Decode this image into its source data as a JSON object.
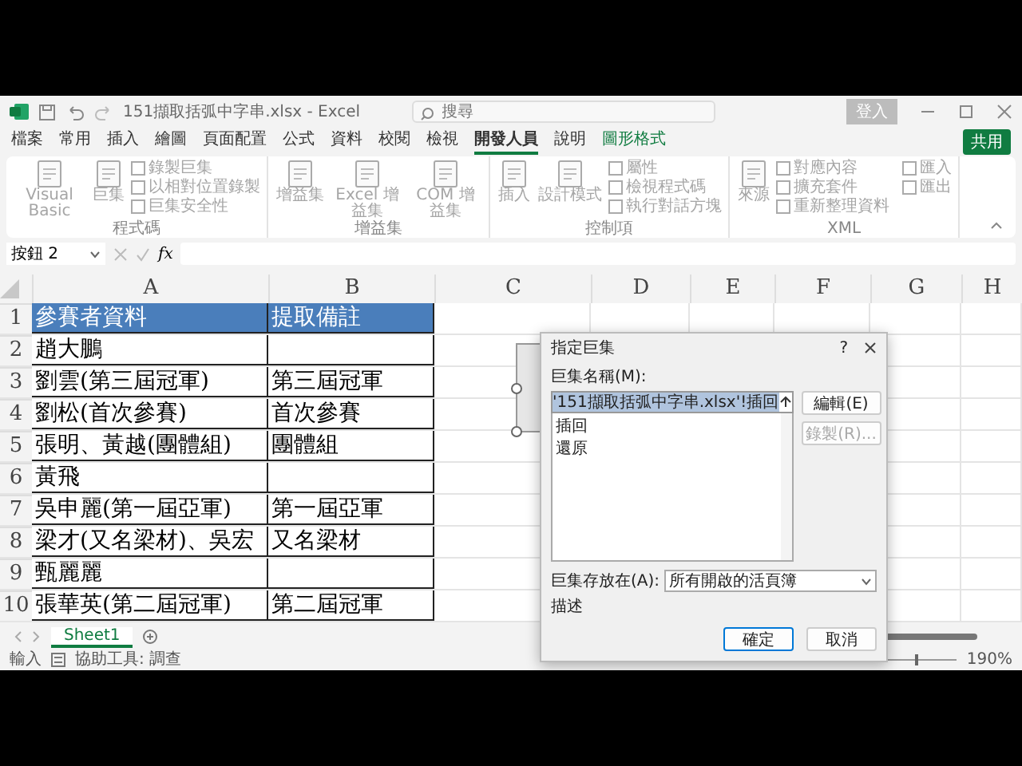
{
  "title_bar": {
    "title": "151擷取括弧中字串.xlsx - Excel",
    "search_placeholder": "搜尋",
    "sign_in": "登入"
  },
  "menu_tabs": [
    {
      "label": "檔案",
      "selected": false,
      "contextual": false
    },
    {
      "label": "常用",
      "selected": false,
      "contextual": false
    },
    {
      "label": "插入",
      "selected": false,
      "contextual": false
    },
    {
      "label": "繪圖",
      "selected": false,
      "contextual": false
    },
    {
      "label": "頁面配置",
      "selected": false,
      "contextual": false
    },
    {
      "label": "公式",
      "selected": false,
      "contextual": false
    },
    {
      "label": "資料",
      "selected": false,
      "contextual": false
    },
    {
      "label": "校閱",
      "selected": false,
      "contextual": false
    },
    {
      "label": "檢視",
      "selected": false,
      "contextual": false
    },
    {
      "label": "開發人員",
      "selected": true,
      "contextual": false
    },
    {
      "label": "說明",
      "selected": false,
      "contextual": false
    },
    {
      "label": "圖形格式",
      "selected": false,
      "contextual": true
    }
  ],
  "share_button": "共用",
  "ribbon_groups": [
    {
      "label": "程式碼",
      "disabled": true,
      "large": [
        "Visual Basic",
        "巨集"
      ],
      "small": [
        "錄製巨集",
        "以相對位置錄製",
        "巨集安全性"
      ]
    },
    {
      "label": "增益集",
      "disabled": true,
      "large": [
        "增益集",
        "Excel 增益集",
        "COM 增益集"
      ]
    },
    {
      "label": "控制項",
      "disabled": true,
      "large": [
        "插入",
        "設計模式"
      ],
      "small": [
        "屬性",
        "檢視程式碼",
        "執行對話方塊"
      ]
    },
    {
      "label": "XML",
      "disabled": true,
      "large": [
        "來源"
      ],
      "small": [
        "對應內容",
        "擴充套件",
        "重新整理資料",
        "匯入",
        "匯出"
      ]
    }
  ],
  "formula_bar": {
    "name_box": "按鈕 2",
    "fx": "fx"
  },
  "sheet": {
    "columns": [
      "A",
      "B",
      "C",
      "D",
      "E",
      "F",
      "G",
      "H"
    ],
    "rows": [
      {
        "number": "1",
        "header": true,
        "cells": [
          "參賽者資料",
          "提取備註"
        ]
      },
      {
        "number": "2",
        "header": false,
        "cells": [
          "趙大鵬",
          ""
        ]
      },
      {
        "number": "3",
        "header": false,
        "cells": [
          "劉雲(第三屆冠軍)",
          "第三屆冠軍"
        ]
      },
      {
        "number": "4",
        "header": false,
        "cells": [
          "劉松(首次參賽)",
          "首次參賽"
        ]
      },
      {
        "number": "5",
        "header": false,
        "cells": [
          "張明、黃越(團體組)",
          "團體組"
        ]
      },
      {
        "number": "6",
        "header": false,
        "cells": [
          "黃飛",
          ""
        ]
      },
      {
        "number": "7",
        "header": false,
        "cells": [
          "吳申麗(第一屆亞軍)",
          "第一屆亞軍"
        ]
      },
      {
        "number": "8",
        "header": false,
        "cells": [
          "梁才(又名梁材)、吳宏",
          "又名梁材"
        ]
      },
      {
        "number": "9",
        "header": false,
        "cells": [
          "甄麗麗",
          ""
        ]
      },
      {
        "number": "10",
        "header": false,
        "cells": [
          "張華英(第二屆冠軍)",
          "第二屆冠軍"
        ]
      }
    ]
  },
  "dialog": {
    "title": "指定巨集",
    "help": "?",
    "name_label": "巨集名稱(M):",
    "name_value": "'151擷取括弧中字串.xlsx'!插回",
    "macros": [
      {
        "label": "插回",
        "selected": false
      },
      {
        "label": "還原",
        "selected": false
      }
    ],
    "edit_button": {
      "label": "編輯(E)",
      "disabled": false
    },
    "record_button": {
      "label": "錄製(R)...",
      "disabled": true
    },
    "store_label": "巨集存放在(A):",
    "store_value": "所有開啟的活頁簿",
    "description_label": "描述",
    "ok": "確定",
    "cancel": "取消"
  },
  "sheet_tabs": [
    {
      "label": "Sheet1",
      "selected": true
    }
  ],
  "status_bar": {
    "mode": "輸入",
    "accessibility": "協助工具: 調查",
    "zoom": "190%",
    "zoom_slider": {
      "level": 0.5
    }
  }
}
